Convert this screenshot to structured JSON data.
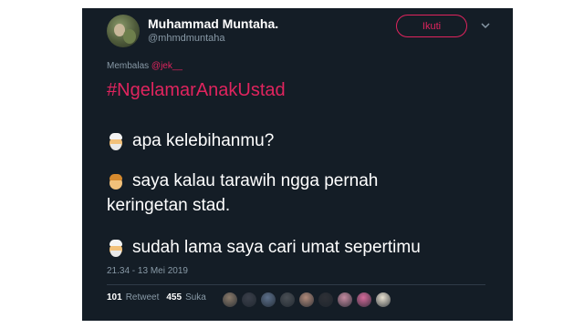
{
  "author": {
    "display_name": "Muhammad Muntaha.",
    "handle": "@mhmdmuntaha"
  },
  "follow_button": "Ikuti",
  "reply": {
    "prefix": "Membalas",
    "mention": "@jek__"
  },
  "tweet": {
    "hashtag": "#NgelamarAnakUstad",
    "lines": [
      {
        "emoji": "old-man-cap-icon",
        "text": "apa kelebihanmu?"
      },
      {
        "emoji": "boy-icon",
        "text": "saya kalau tarawih ngga pernah"
      },
      {
        "emoji": "",
        "text": "keringetan stad."
      },
      {
        "emoji": "old-man-cap-icon",
        "text": "sudah lama saya cari umat sepertimu"
      }
    ]
  },
  "timestamp": "21.34 - 13 Mei 2019",
  "stats": {
    "retweets_count": "101",
    "retweets_label": "Retweet",
    "likes_count": "455",
    "likes_label": "Suka"
  },
  "likers": [
    "#8a7a6a",
    "#3a3f4a",
    "#5c6f8a",
    "#4a4f55",
    "#b08a7a",
    "#2e3036",
    "#c48aa0",
    "#d46a9a",
    "#e8e0d0"
  ],
  "colors": {
    "background": "#141d26",
    "accent": "#e0245e",
    "muted": "#8899a6"
  }
}
